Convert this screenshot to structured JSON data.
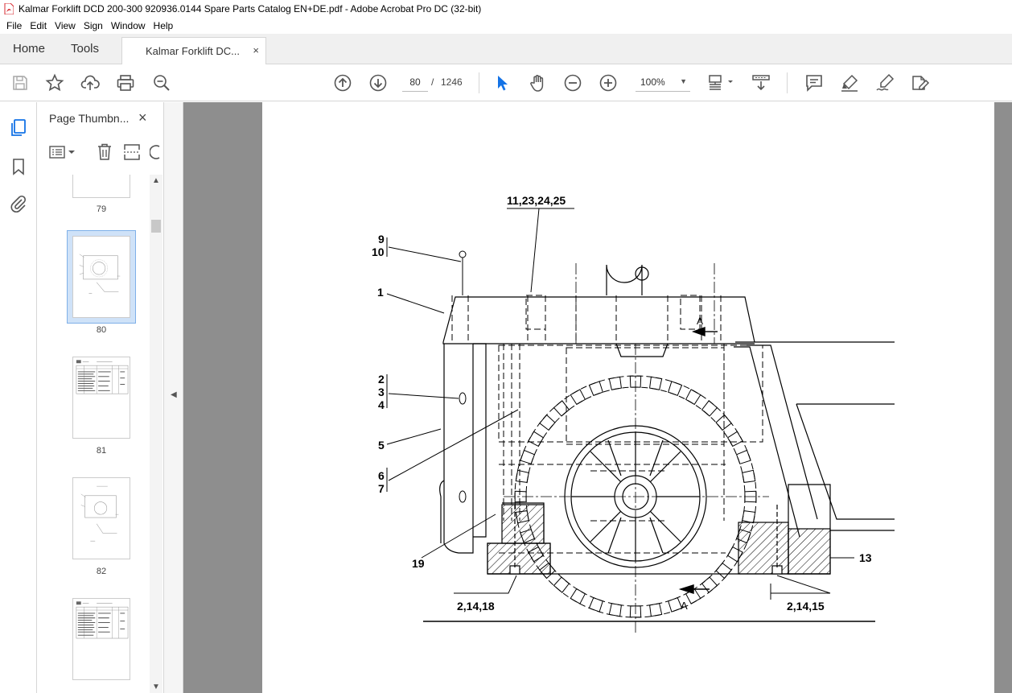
{
  "window": {
    "title": "Kalmar Forklift DCD 200-300 920936.0144 Spare Parts Catalog EN+DE.pdf - Adobe Acrobat Pro DC (32-bit)"
  },
  "menu": [
    "File",
    "Edit",
    "View",
    "Sign",
    "Window",
    "Help"
  ],
  "tabs": {
    "home": "Home",
    "tools": "Tools",
    "document": "Kalmar Forklift DC...",
    "close": "×"
  },
  "toolbar": {
    "current_page": "80",
    "page_separator": "/",
    "total_pages": "1246",
    "zoom": "100%",
    "icons": [
      "save-icon",
      "star-icon",
      "upload-icon",
      "print-icon",
      "zoom-search-icon",
      "page-up-icon",
      "page-down-icon",
      "select-arrow-icon",
      "hand-icon",
      "zoom-out-icon",
      "zoom-in-icon",
      "page-display-icon",
      "scroll-mode-icon",
      "comment-icon",
      "highlight-icon",
      "sign-icon",
      "edit-pdf-icon"
    ]
  },
  "thumbnail_panel": {
    "title": "Page Thumbn...",
    "close": "×",
    "pages": [
      {
        "number": "79"
      },
      {
        "number": "80",
        "selected": true
      },
      {
        "number": "81"
      },
      {
        "number": "82"
      },
      {
        "number": ""
      }
    ]
  },
  "drawing": {
    "labels": {
      "top_callout": "11,23,24,25",
      "l9": "9",
      "l10": "10",
      "l1": "1",
      "l2": "2",
      "l3": "3",
      "l4": "4",
      "l5": "5",
      "l6": "6",
      "l7": "7",
      "l19": "19",
      "l13": "13",
      "bottom_left": "2,14,18",
      "bottom_right": "2,14,15",
      "section_a_top": "A",
      "section_a_bottom": "A"
    }
  },
  "colors": {
    "accent": "#1473e6",
    "doc_background": "#8e8e8e",
    "title_icon": "#d7282f"
  }
}
